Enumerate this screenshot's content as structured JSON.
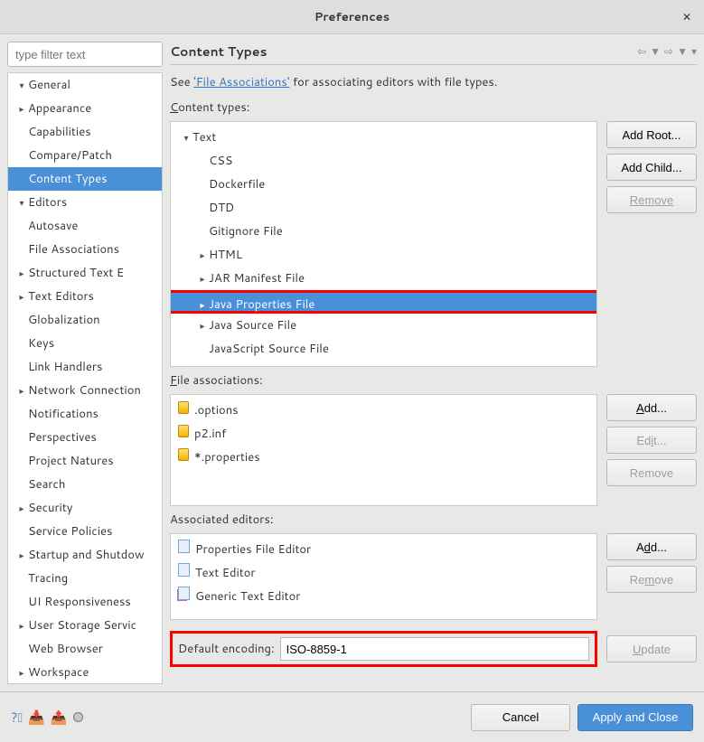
{
  "window": {
    "title": "Preferences"
  },
  "sidebar": {
    "filter_placeholder": "type filter text",
    "items": [
      {
        "label": "General",
        "exp": true,
        "depth": 0
      },
      {
        "label": "Appearance",
        "exp": false,
        "depth": 1,
        "arrow": true
      },
      {
        "label": "Capabilities",
        "depth": 1
      },
      {
        "label": "Compare/Patch",
        "depth": 1
      },
      {
        "label": "Content Types",
        "depth": 1,
        "selected": true
      },
      {
        "label": "Editors",
        "exp": true,
        "depth": 1,
        "arrow": true
      },
      {
        "label": "Autosave",
        "depth": 2
      },
      {
        "label": "File Associations",
        "depth": 2
      },
      {
        "label": "Structured Text E",
        "depth": 2,
        "arrow": true
      },
      {
        "label": "Text Editors",
        "depth": 2,
        "arrow": true
      },
      {
        "label": "Globalization",
        "depth": 1
      },
      {
        "label": "Keys",
        "depth": 1
      },
      {
        "label": "Link Handlers",
        "depth": 1
      },
      {
        "label": "Network Connection",
        "depth": 1,
        "arrow": true
      },
      {
        "label": "Notifications",
        "depth": 1
      },
      {
        "label": "Perspectives",
        "depth": 1
      },
      {
        "label": "Project Natures",
        "depth": 1
      },
      {
        "label": "Search",
        "depth": 1
      },
      {
        "label": "Security",
        "depth": 1,
        "arrow": true
      },
      {
        "label": "Service Policies",
        "depth": 1
      },
      {
        "label": "Startup and Shutdow",
        "depth": 1,
        "arrow": true
      },
      {
        "label": "Tracing",
        "depth": 1
      },
      {
        "label": "UI Responsiveness",
        "depth": 1
      },
      {
        "label": "User Storage Servic",
        "depth": 1,
        "arrow": true
      },
      {
        "label": "Web Browser",
        "depth": 1
      },
      {
        "label": "Workspace",
        "depth": 1,
        "arrow": true
      }
    ]
  },
  "page": {
    "title": "Content Types",
    "intro_pre": "See ",
    "intro_link": "'File Associations'",
    "intro_post": " for associating editors with file types.",
    "content_types_label": "Content types:",
    "content_types": [
      {
        "label": "Text",
        "exp": true,
        "depth": 0
      },
      {
        "label": "CSS",
        "depth": 1
      },
      {
        "label": "Dockerfile",
        "depth": 1
      },
      {
        "label": "DTD",
        "depth": 1
      },
      {
        "label": "Gitignore File",
        "depth": 1
      },
      {
        "label": "HTML",
        "depth": 1,
        "arrow": true
      },
      {
        "label": "JAR Manifest File",
        "depth": 1,
        "arrow": true
      },
      {
        "label": "Java Properties File",
        "depth": 1,
        "arrow": true,
        "selected": true,
        "highlight": true
      },
      {
        "label": "Java Source File",
        "depth": 1,
        "arrow": true
      },
      {
        "label": "JavaScript Source File",
        "depth": 1
      }
    ],
    "ct_buttons": {
      "add_root": "Add Root...",
      "add_child": "Add Child...",
      "remove": "Remove"
    },
    "file_assoc_label": "File associations:",
    "file_assoc": [
      ".options",
      "p2.inf",
      "*.properties"
    ],
    "fa_buttons": {
      "add": "Add...",
      "edit": "Edit...",
      "remove": "Remove"
    },
    "assoc_editors_label": "Associated editors:",
    "assoc_editors": [
      "Properties File Editor",
      "Text Editor",
      "Generic Text Editor"
    ],
    "ae_buttons": {
      "add": "Add...",
      "remove": "Remove"
    },
    "encoding_label": "Default encoding:",
    "encoding_value": "ISO-8859-1",
    "update_label": "Update"
  },
  "footer": {
    "cancel": "Cancel",
    "apply": "Apply and Close"
  }
}
